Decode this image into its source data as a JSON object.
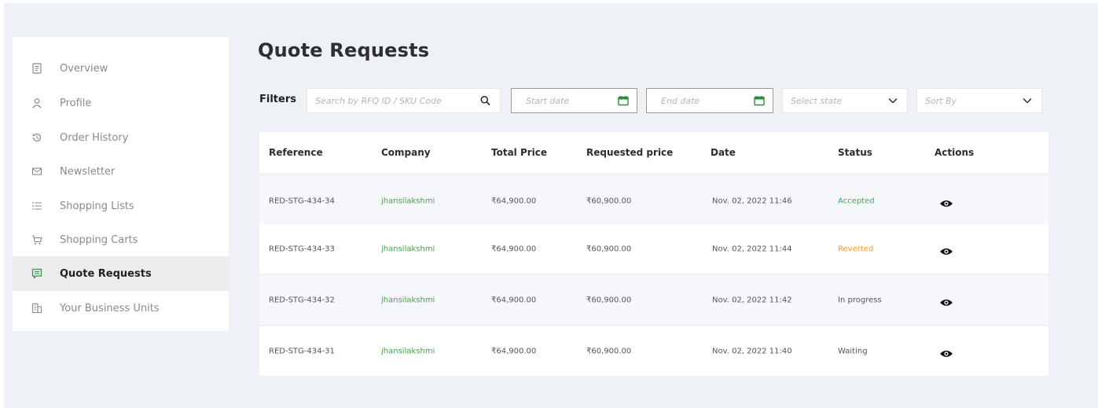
{
  "sidebar": {
    "items": [
      {
        "label": "Overview",
        "icon": "document-icon"
      },
      {
        "label": "Profile",
        "icon": "user-icon"
      },
      {
        "label": "Order History",
        "icon": "history-icon"
      },
      {
        "label": "Newsletter",
        "icon": "mail-icon"
      },
      {
        "label": "Shopping Lists",
        "icon": "list-icon"
      },
      {
        "label": "Shopping Carts",
        "icon": "cart-icon"
      },
      {
        "label": "Quote Requests",
        "icon": "quote-icon",
        "active": true
      },
      {
        "label": "Your Business Units",
        "icon": "building-icon"
      }
    ]
  },
  "main": {
    "title": "Quote Requests",
    "filters": {
      "label": "Filters",
      "search_placeholder": "Search by RFQ ID / SKU Code",
      "start_date_placeholder": "Start date",
      "end_date_placeholder": "End date",
      "state_placeholder": "Select state",
      "sort_placeholder": "Sort By"
    },
    "table": {
      "headers": [
        "Reference",
        "Company",
        "Total Price",
        "Requested price",
        "Date",
        "Status",
        "Actions"
      ],
      "rows": [
        {
          "reference": "RED-STG-434-34",
          "company": "jhansilakshmi",
          "total_price": "₹64,900.00",
          "requested_price": "₹60,900.00",
          "date": "Nov. 02, 2022 11:46",
          "status": "Accepted"
        },
        {
          "reference": "RED-STG-434-33",
          "company": "jhansilakshmi",
          "total_price": "₹64,900.00",
          "requested_price": "₹60,900.00",
          "date": "Nov. 02, 2022 11:44",
          "status": "Reverted"
        },
        {
          "reference": "RED-STG-434-32",
          "company": "jhansilakshmi",
          "total_price": "₹64,900.00",
          "requested_price": "₹60,900.00",
          "date": "Nov. 02, 2022 11:42",
          "status": "In progress"
        },
        {
          "reference": "RED-STG-434-31",
          "company": "jhansilakshmi",
          "total_price": "₹64,900.00",
          "requested_price": "₹60,900.00",
          "date": "Nov. 02, 2022 11:40",
          "status": "Waiting"
        }
      ]
    }
  },
  "colors": {
    "background": "#eef1f6",
    "accent_green": "#4aa34a",
    "status_accepted": "#2fb35f",
    "status_reverted": "#f39c2e",
    "calendar_icon": "#2e8b3e"
  }
}
